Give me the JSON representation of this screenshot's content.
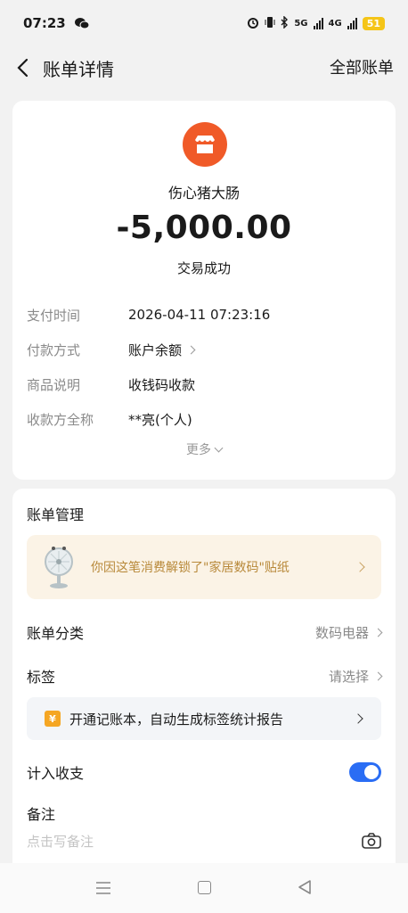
{
  "status_bar": {
    "time": "07:23",
    "network_5g": "5G",
    "network_4g": "4G",
    "battery": "51"
  },
  "header": {
    "title": "账单详情",
    "right_action": "全部账单"
  },
  "transaction": {
    "merchant": "伤心猪大肠",
    "amount": "-5,000.00",
    "status": "交易成功",
    "details": [
      {
        "label": "支付时间",
        "value": "2026-04-11 07:23:16"
      },
      {
        "label": "付款方式",
        "value": "账户余额"
      },
      {
        "label": "商品说明",
        "value": "收钱码收款"
      },
      {
        "label": "收款方全称",
        "value": "**亮(个人)"
      }
    ],
    "more_label": "更多"
  },
  "management": {
    "title": "账单管理",
    "sticker_text": "你因这笔消费解锁了\"家居数码\"贴纸",
    "category_label": "账单分类",
    "category_value": "数码电器",
    "tag_label": "标签",
    "tag_value": "请选择",
    "promo_icon_text": "¥",
    "promo_text": "开通记账本，自动生成标签统计报告",
    "count_label": "计入收支",
    "count_enabled": true,
    "remark_label": "备注",
    "remark_placeholder": "点击写备注"
  },
  "colors": {
    "accent": "#2a6df4",
    "merchant_logo": "#f05a28",
    "sticker_text": "#b8893a"
  }
}
